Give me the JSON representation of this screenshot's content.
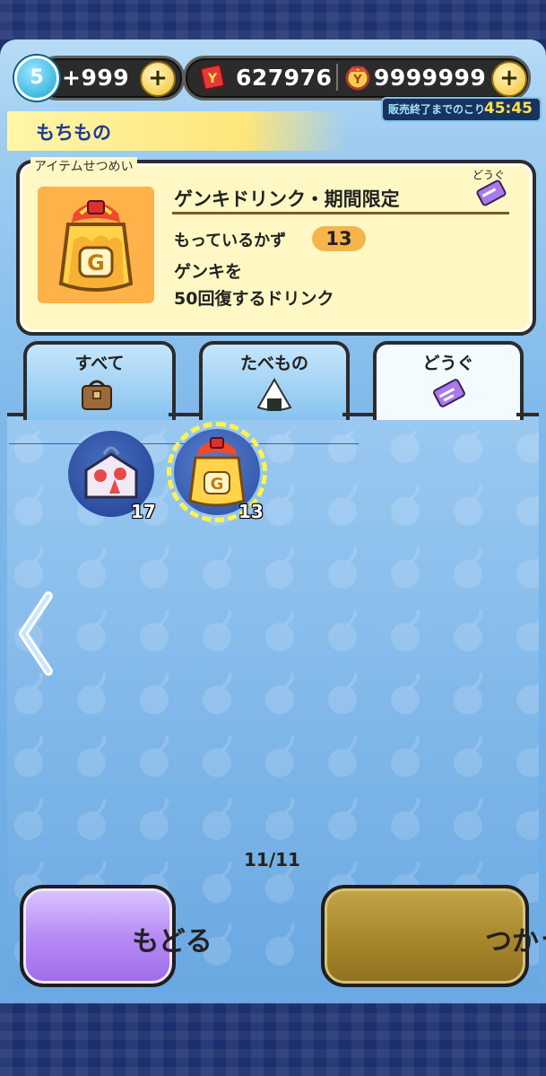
{
  "status_bar": {
    "stamina_level": "5",
    "stamina_value": "+999",
    "ticket_value": "627976",
    "coin_value": "9999999",
    "plus_symbol": "+",
    "sale_label": "販売終了までのこり",
    "sale_timer": "45:45"
  },
  "header": {
    "title": "もちもの"
  },
  "item_info": {
    "section_label": "アイテムせつめい",
    "name": "ゲンキドリンク・期間限定",
    "category_tag": "どうぐ",
    "have_label": "もっているかず",
    "have_count": "13",
    "description_line1": "ゲンキを",
    "description_line2": "50回復するドリンク"
  },
  "tabs": [
    {
      "label": "すべて",
      "icon": "bag-icon",
      "active": false
    },
    {
      "label": "たべもの",
      "icon": "onigiri-icon",
      "active": false
    },
    {
      "label": "どうぐ",
      "icon": "ticket-icon",
      "active": true
    }
  ],
  "items": [
    {
      "icon": "charm-board-icon",
      "count": "17",
      "selected": false
    },
    {
      "icon": "genki-drink-icon",
      "count": "13",
      "selected": true
    }
  ],
  "pagination": {
    "text": "11/11"
  },
  "buttons": {
    "back": "もどる",
    "use": "つかう"
  },
  "colors": {
    "panel_top": "#b7dcf6",
    "panel_bottom": "#6aa9e3",
    "card_bg": "#fff8c4",
    "back_button": "#b78cf4",
    "use_button": "#a8862a",
    "selection_ring": "#fff44a"
  }
}
